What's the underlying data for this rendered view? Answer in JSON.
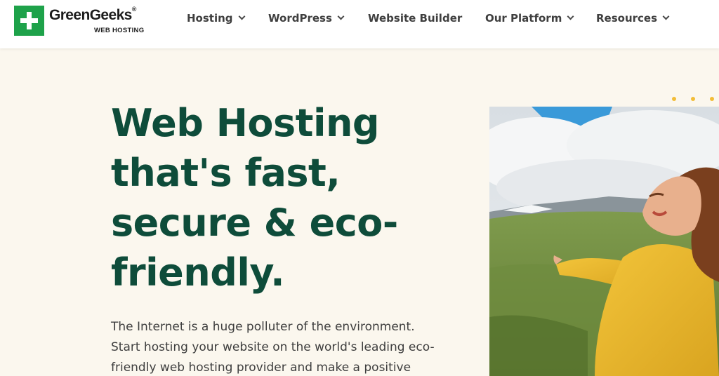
{
  "header": {
    "logo": {
      "name": "GreenGeeks",
      "registered": "®",
      "sub": "WEB HOSTING"
    },
    "nav": [
      {
        "label": "Hosting",
        "has_dropdown": true
      },
      {
        "label": "WordPress",
        "has_dropdown": true
      },
      {
        "label": "Website Builder",
        "has_dropdown": false
      },
      {
        "label": "Our Platform",
        "has_dropdown": true
      },
      {
        "label": "Resources",
        "has_dropdown": true
      }
    ]
  },
  "hero": {
    "title_lines": [
      "Web Hosting",
      "that's fast,",
      "secure & eco-",
      "friendly."
    ],
    "body_lines": [
      "The Internet is a huge polluter of the environment.",
      "Start hosting your website on the world's leading eco-",
      "friendly web hosting provider and make a positive"
    ]
  },
  "colors": {
    "brand_green": "#1ea24a",
    "heading_green": "#0e4c3a",
    "background": "#fbf7ee",
    "accent_dots": "#f2bd38"
  }
}
